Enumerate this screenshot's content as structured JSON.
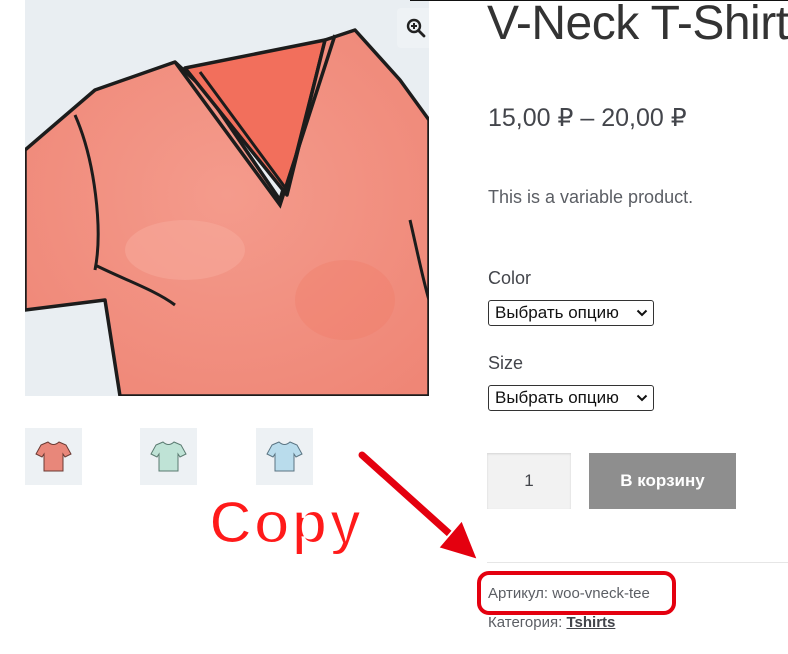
{
  "product": {
    "title": "V-Neck T-Shirt",
    "price": "15,00 ₽ – 20,00 ₽",
    "description": "This is a variable product."
  },
  "gallery": {
    "zoom_icon": "zoom-in-icon",
    "thumbnails": [
      {
        "color": "#e8877a",
        "selected": true
      },
      {
        "color": "#bfe3d6",
        "selected": false
      },
      {
        "color": "#b9dcec",
        "selected": false
      }
    ]
  },
  "attributes": [
    {
      "label": "Color",
      "selected": "Выбрать опцию"
    },
    {
      "label": "Size",
      "selected": "Выбрать опцию"
    }
  ],
  "cart": {
    "quantity": "1",
    "button_label": "В корзину"
  },
  "meta": {
    "sku_label": "Артикул:",
    "sku_value": "woo-vneck-tee",
    "category_label": "Категория:",
    "category_value": "Tshirts"
  },
  "annotation": {
    "text": "Copy",
    "color": "#e4000f"
  }
}
